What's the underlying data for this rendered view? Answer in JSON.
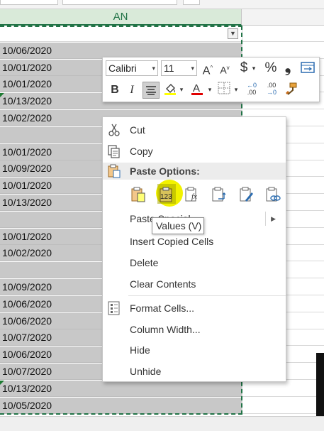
{
  "column_header": "AN",
  "rows": [
    {
      "value": "",
      "marker": false
    },
    {
      "value": "10/06/2020",
      "marker": false
    },
    {
      "value": "10/01/2020",
      "marker": false
    },
    {
      "value": "10/01/2020",
      "marker": false
    },
    {
      "value": "10/13/2020",
      "marker": true
    },
    {
      "value": "10/02/2020",
      "marker": false
    },
    {
      "value": "",
      "marker": false
    },
    {
      "value": "10/01/2020",
      "marker": false
    },
    {
      "value": "10/09/2020",
      "marker": false
    },
    {
      "value": "10/01/2020",
      "marker": false
    },
    {
      "value": "10/13/2020",
      "marker": false
    },
    {
      "value": "",
      "marker": false
    },
    {
      "value": "10/01/2020",
      "marker": false
    },
    {
      "value": "10/02/2020",
      "marker": false
    },
    {
      "value": "",
      "marker": false
    },
    {
      "value": "10/09/2020",
      "marker": false
    },
    {
      "value": "10/06/2020",
      "marker": false
    },
    {
      "value": "10/06/2020",
      "marker": false
    },
    {
      "value": "10/07/2020",
      "marker": false
    },
    {
      "value": "10/06/2020",
      "marker": false
    },
    {
      "value": "10/07/2020",
      "marker": false
    },
    {
      "value": "10/13/2020",
      "marker": true
    },
    {
      "value": "10/05/2020",
      "marker": false
    }
  ],
  "mini_toolbar": {
    "font_name": "Calibri",
    "font_size": "11",
    "increase_font": "A",
    "decrease_font": "A",
    "currency": "$",
    "percent": "%",
    "comma": "❟",
    "bold": "B",
    "italic": "I",
    "decimals_increase_top": "←0",
    "decimals_increase_bottom": ".00",
    "decimals_decrease_top": ".00",
    "decimals_decrease_bottom": "→0",
    "fill_color": "#ffff00",
    "font_color": "#e00000"
  },
  "context_menu": {
    "cut": "Cut",
    "copy": "Copy",
    "paste_options_header": "Paste Options:",
    "paste_special": "Paste Special...",
    "insert_copied_cells": "Insert Copied Cells",
    "delete": "Delete",
    "clear_contents": "Clear Contents",
    "format_cells": "Format Cells...",
    "column_width": "Column Width...",
    "hide": "Hide",
    "unhide": "Unhide"
  },
  "paste_icons": [
    "paste-icon",
    "paste-values-icon",
    "paste-formulas-icon",
    "paste-transpose-icon",
    "paste-formatting-icon",
    "paste-link-icon"
  ],
  "paste_values_label": "123",
  "paste_formula_label": "fx",
  "tooltip": "Values (V)",
  "colors": {
    "accent": "#217346",
    "highlight": "#f2f200",
    "selection_gray": "#c8c8c8"
  }
}
